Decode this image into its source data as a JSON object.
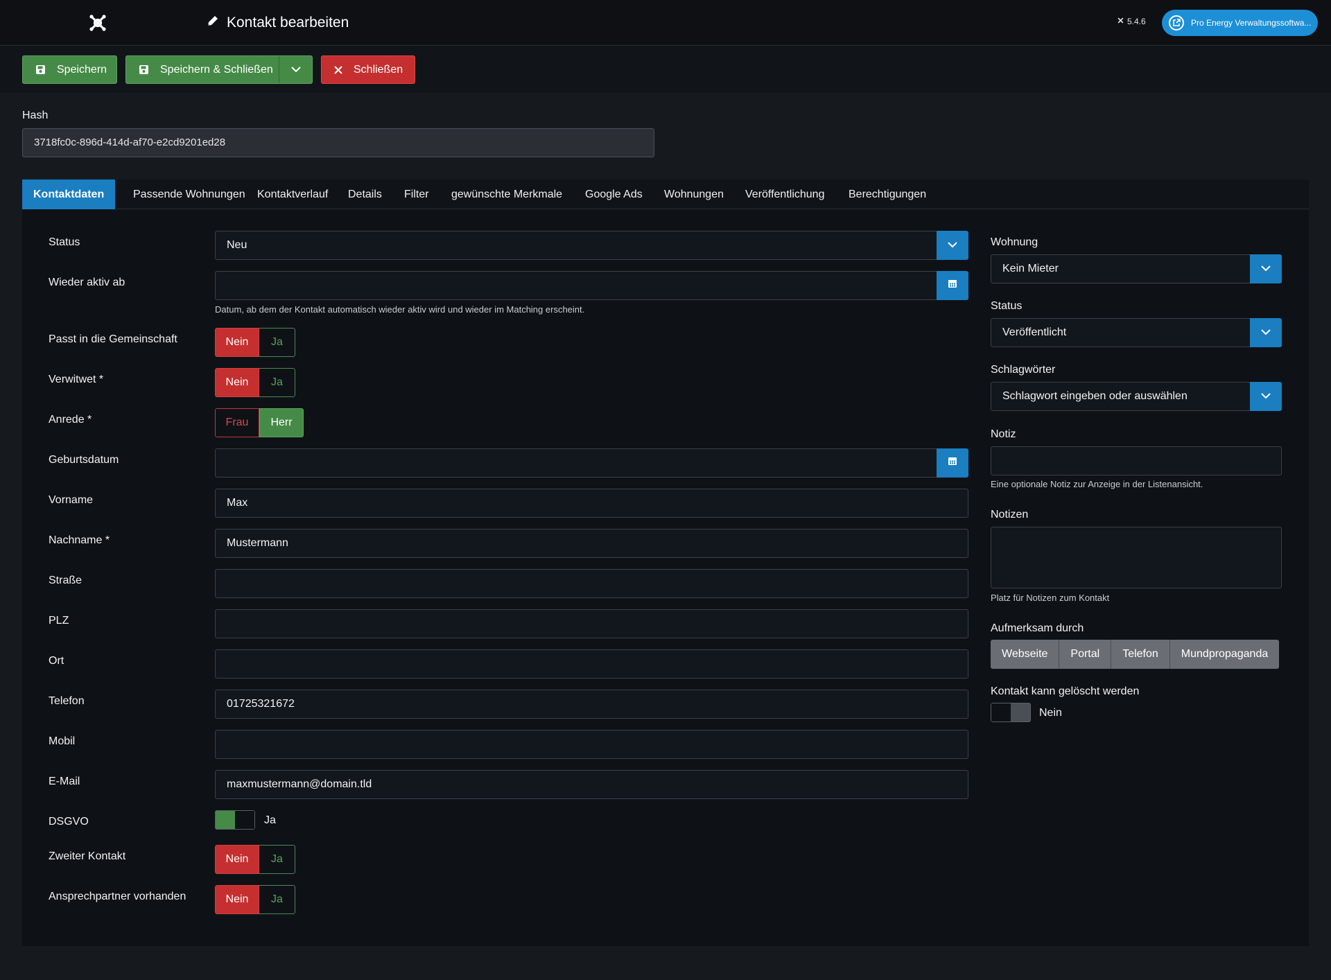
{
  "header": {
    "title": "Kontakt bearbeiten",
    "version": "5.4.6",
    "site_link": "Pro Energy Verwaltungssoftwa..."
  },
  "toolbar": {
    "save": "Speichern",
    "save_close": "Speichern & Schließen",
    "close": "Schließen"
  },
  "hash": {
    "label": "Hash",
    "value": "3718fc0c-896d-414d-af70-e2cd9201ed28"
  },
  "tabs": [
    "Kontaktdaten",
    "Passende Wohnungen",
    "Kontaktverlauf",
    "Details",
    "Filter",
    "gewünschte Merkmale",
    "Google Ads",
    "Wohnungen",
    "Veröffentlichung",
    "Berechtigungen"
  ],
  "active_tab": "Kontaktdaten",
  "form": {
    "status": {
      "label": "Status",
      "value": "Neu"
    },
    "wieder_aktiv": {
      "label": "Wieder aktiv ab",
      "value": "",
      "hint": "Datum, ab dem der Kontakt automatisch wieder aktiv wird und wieder im Matching erscheint."
    },
    "gemeinschaft": {
      "label": "Passt in die Gemeinschaft",
      "no": "Nein",
      "yes": "Ja",
      "selected": "Nein"
    },
    "verwitwet": {
      "label": "Verwitwet *",
      "no": "Nein",
      "yes": "Ja",
      "selected": "Nein"
    },
    "anrede": {
      "label": "Anrede *",
      "frau": "Frau",
      "herr": "Herr",
      "selected": "Herr"
    },
    "geburtsdatum": {
      "label": "Geburtsdatum",
      "value": ""
    },
    "vorname": {
      "label": "Vorname",
      "value": "Max"
    },
    "nachname": {
      "label": "Nachname *",
      "value": "Mustermann"
    },
    "strasse": {
      "label": "Straße",
      "value": ""
    },
    "plz": {
      "label": "PLZ",
      "value": ""
    },
    "ort": {
      "label": "Ort",
      "value": ""
    },
    "telefon": {
      "label": "Telefon",
      "value": "01725321672"
    },
    "mobil": {
      "label": "Mobil",
      "value": ""
    },
    "email": {
      "label": "E-Mail",
      "value": "maxmustermann@domain.tld"
    },
    "dsgvo": {
      "label": "DSGVO",
      "value": "Ja",
      "on": true
    },
    "zweiter_kontakt": {
      "label": "Zweiter Kontakt",
      "no": "Nein",
      "yes": "Ja",
      "selected": "Nein"
    },
    "ansprechpartner": {
      "label": "Ansprechpartner vorhanden",
      "no": "Nein",
      "yes": "Ja",
      "selected": "Nein"
    }
  },
  "sidebar": {
    "wohnung": {
      "label": "Wohnung",
      "value": "Kein Mieter"
    },
    "status": {
      "label": "Status",
      "value": "Veröffentlicht"
    },
    "schlagwoerter": {
      "label": "Schlagwörter",
      "placeholder": "Schlagwort eingeben oder auswählen"
    },
    "notiz": {
      "label": "Notiz",
      "value": "",
      "hint": "Eine optionale Notiz zur Anzeige in der Listenansicht."
    },
    "notizen": {
      "label": "Notizen",
      "value": "",
      "hint": "Platz für Notizen zum Kontakt"
    },
    "aufmerksam": {
      "label": "Aufmerksam durch",
      "options": [
        "Webseite",
        "Portal",
        "Telefon",
        "Mundpropaganda"
      ]
    },
    "loeschbar": {
      "label": "Kontakt kann gelöscht werden",
      "value": "Nein",
      "on": false
    }
  },
  "colors": {
    "primary": "#1a7ec0",
    "success": "#468a47",
    "danger": "#c52f2f",
    "background": "#161a1f"
  }
}
